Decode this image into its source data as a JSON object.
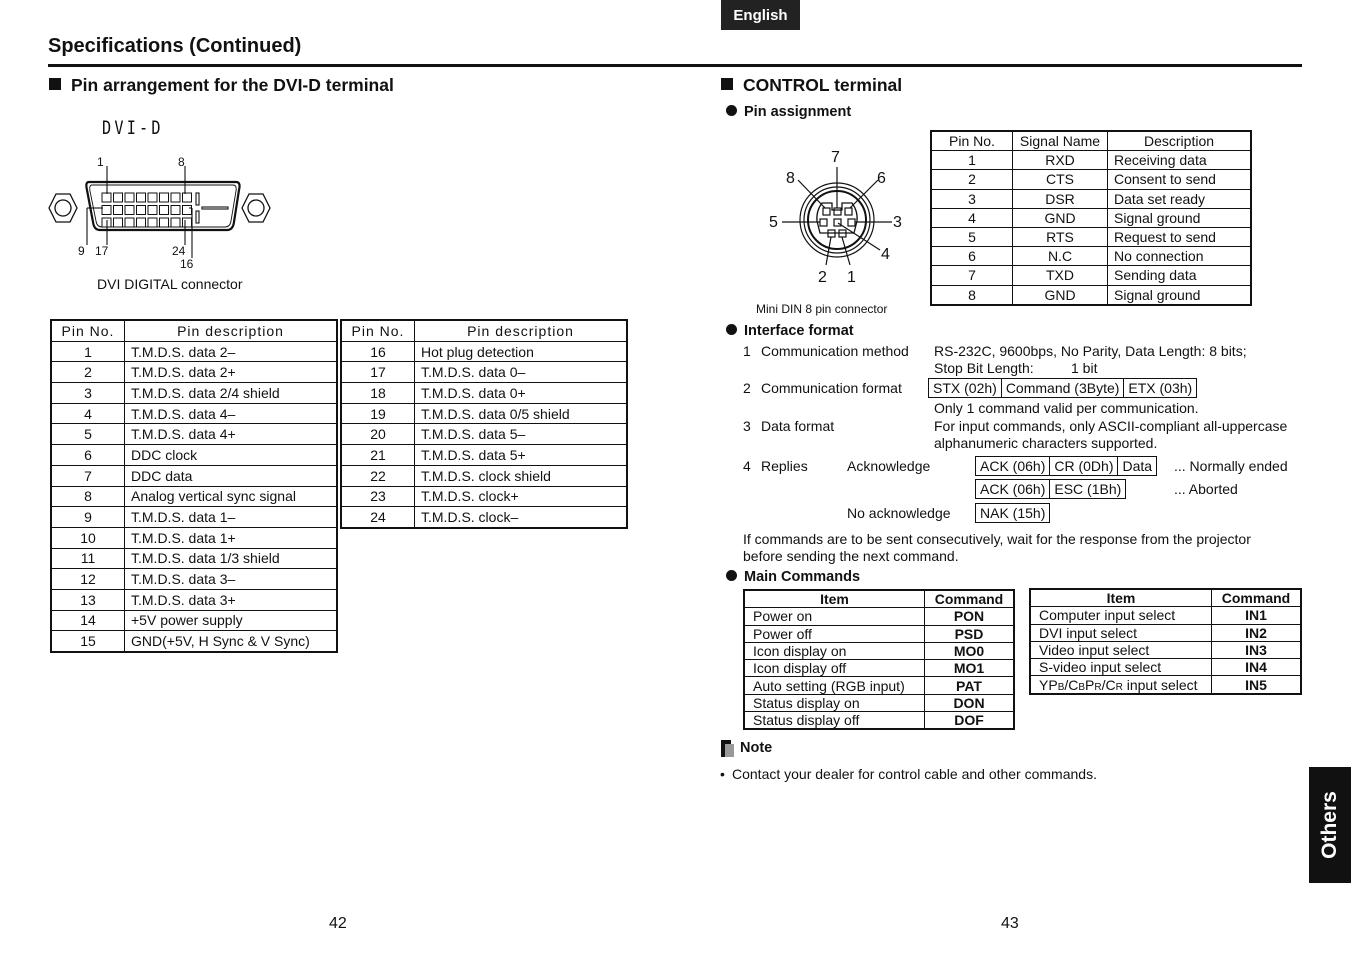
{
  "header": {
    "language_badge": "English",
    "page_title": "Specifications (Continued)"
  },
  "left": {
    "section_title": "Pin arrangement for the DVI-D terminal",
    "diagram": {
      "label": "DVI-D",
      "pin_labels": {
        "p1": "1",
        "p8": "8",
        "p9": "9",
        "p17": "17",
        "p24": "24",
        "p16": "16"
      },
      "caption": "DVI DIGITAL connector"
    },
    "table_headers": {
      "pin_no": "Pin No.",
      "pin_description": "Pin description"
    },
    "pins_left": [
      {
        "pin": "1",
        "desc": "T.M.D.S. data 2–"
      },
      {
        "pin": "2",
        "desc": "T.M.D.S. data 2+"
      },
      {
        "pin": "3",
        "desc": "T.M.D.S. data 2/4 shield"
      },
      {
        "pin": "4",
        "desc": "T.M.D.S. data 4–"
      },
      {
        "pin": "5",
        "desc": "T.M.D.S. data 4+"
      },
      {
        "pin": "6",
        "desc": "DDC clock"
      },
      {
        "pin": "7",
        "desc": "DDC data"
      },
      {
        "pin": "8",
        "desc": "Analog vertical sync signal"
      },
      {
        "pin": "9",
        "desc": "T.M.D.S. data 1–"
      },
      {
        "pin": "10",
        "desc": "T.M.D.S. data 1+"
      },
      {
        "pin": "11",
        "desc": "T.M.D.S. data 1/3 shield"
      },
      {
        "pin": "12",
        "desc": "T.M.D.S. data 3–"
      },
      {
        "pin": "13",
        "desc": "T.M.D.S. data 3+"
      },
      {
        "pin": "14",
        "desc": "+5V power supply"
      },
      {
        "pin": "15",
        "desc": "GND(+5V, H Sync & V Sync)"
      }
    ],
    "pins_right": [
      {
        "pin": "16",
        "desc": "Hot plug detection"
      },
      {
        "pin": "17",
        "desc": "T.M.D.S. data 0–"
      },
      {
        "pin": "18",
        "desc": "T.M.D.S. data 0+"
      },
      {
        "pin": "19",
        "desc": "T.M.D.S. data 0/5 shield"
      },
      {
        "pin": "20",
        "desc": "T.M.D.S. data 5–"
      },
      {
        "pin": "21",
        "desc": "T.M.D.S. data 5+"
      },
      {
        "pin": "22",
        "desc": "T.M.D.S. clock shield"
      },
      {
        "pin": "23",
        "desc": "T.M.D.S. clock+"
      },
      {
        "pin": "24",
        "desc": "T.M.D.S. clock–"
      }
    ],
    "page_number": "42"
  },
  "right": {
    "section_title": "CONTROL terminal",
    "pin_assignment": {
      "title": "Pin assignment",
      "diagram_labels": {
        "p1": "1",
        "p2": "2",
        "p3": "3",
        "p4": "4",
        "p5": "5",
        "p6": "6",
        "p7": "7",
        "p8": "8"
      },
      "caption": "Mini DIN 8 pin connector",
      "headers": {
        "pin_no": "Pin No.",
        "signal": "Signal Name",
        "description": "Description"
      },
      "rows": [
        {
          "pin": "1",
          "signal": "RXD",
          "desc": "Receiving data"
        },
        {
          "pin": "2",
          "signal": "CTS",
          "desc": "Consent to send"
        },
        {
          "pin": "3",
          "signal": "DSR",
          "desc": "Data set ready"
        },
        {
          "pin": "4",
          "signal": "GND",
          "desc": "Signal ground"
        },
        {
          "pin": "5",
          "signal": "RTS",
          "desc": "Request to send"
        },
        {
          "pin": "6",
          "signal": "N.C",
          "desc": "No connection"
        },
        {
          "pin": "7",
          "signal": "TXD",
          "desc": "Sending data"
        },
        {
          "pin": "8",
          "signal": "GND",
          "desc": "Signal ground"
        }
      ]
    },
    "interface_format": {
      "title": "Interface format",
      "item1": {
        "num": "1",
        "label": "Communication method",
        "line1": "RS-232C, 9600bps, No Parity, Data Length: 8 bits;",
        "line2_label": "Stop Bit Length:",
        "line2_value": "1 bit"
      },
      "item2": {
        "num": "2",
        "label": "Communication format",
        "boxes": [
          "STX (02h)",
          "Command (3Byte)",
          "ETX (03h)"
        ],
        "note": "Only 1 command valid per communication."
      },
      "item3": {
        "num": "3",
        "label": "Data format",
        "line1": "For input commands, only ASCII-compliant all-uppercase",
        "line2": "alphanumeric characters supported."
      },
      "item4": {
        "num": "4",
        "label": "Replies",
        "ack_label": "Acknowledge",
        "ack_normal_boxes": [
          "ACK (06h)",
          "CR (0Dh)",
          "Data"
        ],
        "ack_normal_result": "...  Normally ended",
        "ack_abort_boxes": [
          "ACK (06h)",
          "ESC (1Bh)"
        ],
        "ack_abort_result": "...  Aborted",
        "nak_label": "No acknowledge",
        "nak_boxes": [
          "NAK (15h)"
        ]
      },
      "consecutive_note_line1": "If commands are to be sent consecutively, wait for the response from the projector",
      "consecutive_note_line2": "before sending the next command."
    },
    "main_commands": {
      "title": "Main Commands",
      "headers": {
        "item": "Item",
        "command": "Command"
      },
      "table1": [
        {
          "item": "Power on",
          "cmd": "PON"
        },
        {
          "item": "Power off",
          "cmd": "PSD"
        },
        {
          "item": "Icon display on",
          "cmd": "MO0"
        },
        {
          "item": "Icon display off",
          "cmd": "MO1"
        },
        {
          "item": "Auto setting (RGB input)",
          "cmd": "PAT"
        },
        {
          "item": "Status display on",
          "cmd": "DON"
        },
        {
          "item": "Status display off",
          "cmd": "DOF"
        }
      ],
      "table2": [
        {
          "item": "Computer input select",
          "cmd": "IN1"
        },
        {
          "item": "DVI input select",
          "cmd": "IN2"
        },
        {
          "item": "Video input select",
          "cmd": "IN3"
        },
        {
          "item": "S-video input select",
          "cmd": "IN4"
        },
        {
          "item": "YPB/CBPR/CR input select",
          "cmd": "IN5"
        }
      ]
    },
    "note": {
      "title": "Note",
      "bullet": "•",
      "text": "Contact your dealer for control cable and other commands."
    },
    "side_tab": "Others",
    "page_number": "43"
  }
}
